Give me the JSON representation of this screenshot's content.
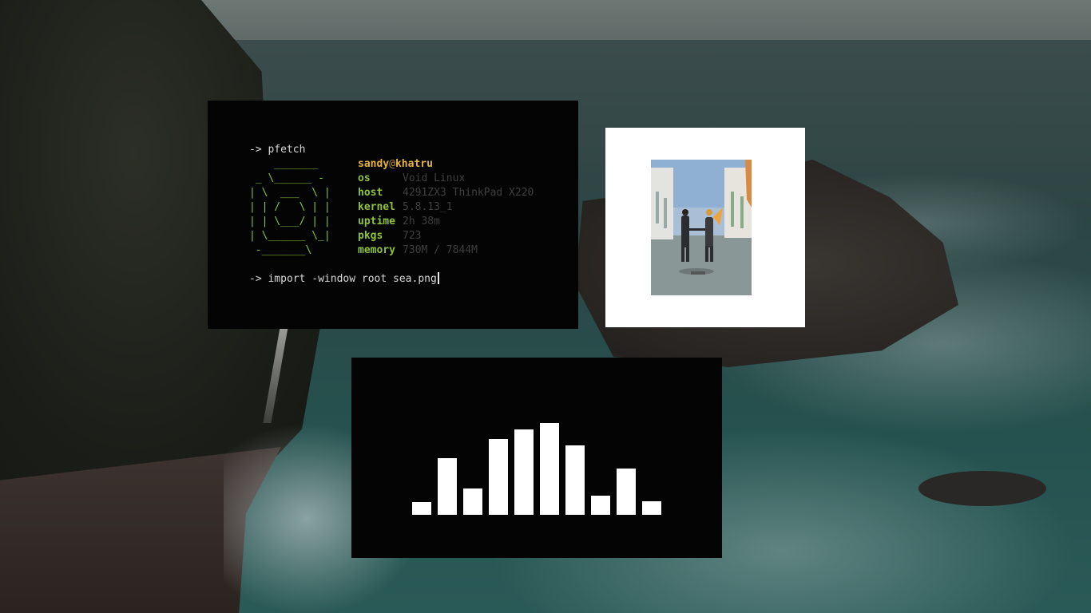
{
  "terminal": {
    "prompt_symbol": "->",
    "command_1": "pfetch",
    "command_2": "import -window root sea.png",
    "ascii_logo": "    _______\n _ \\______ -\n| \\  ___  \\ |\n| | /   \\ | |\n| | \\___/ | |\n| \\______ \\_|\n -_______\\",
    "user": "sandy",
    "at": "@",
    "hostname": "khatru",
    "info": [
      {
        "key": "os",
        "value": "Void Linux"
      },
      {
        "key": "host",
        "value": "4291ZX3 ThinkPad X220"
      },
      {
        "key": "kernel",
        "value": "5.8.13_1"
      },
      {
        "key": "uptime",
        "value": "2h 38m"
      },
      {
        "key": "pkgs",
        "value": "723"
      },
      {
        "key": "memory",
        "value": "730M / 7844M"
      }
    ],
    "colors": {
      "accent": "#8fc23a",
      "user": "#e6b43a",
      "value": "#3f3f3f"
    }
  },
  "album_widget": {
    "icon": "album-cover-image"
  },
  "visualizer": {
    "bar_levels": [
      0.14,
      0.62,
      0.29,
      0.83,
      0.93,
      1.0,
      0.76,
      0.21,
      0.5,
      0.15
    ],
    "bar_color": "#ffffff"
  }
}
